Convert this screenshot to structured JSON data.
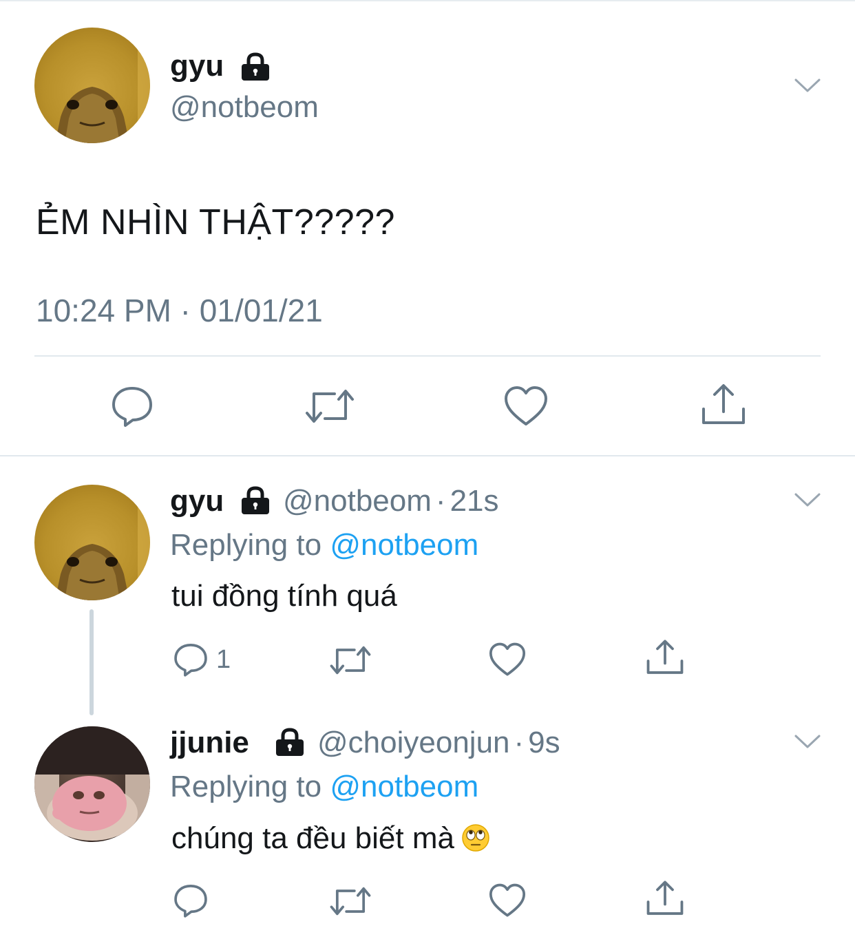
{
  "main_tweet": {
    "display_name": "gyu",
    "handle": "@notbeom",
    "text": "ẺM NHÌN THẬT?????",
    "timestamp": "10:24 PM · 01/01/21",
    "actions": [
      "reply-icon",
      "retweet-icon",
      "like-icon",
      "share-icon"
    ]
  },
  "replies": [
    {
      "display_name": "gyu",
      "handle": "@notbeom",
      "separator": "·",
      "time": "21s",
      "replying_prefix": "Replying to ",
      "replying_to": "@notbeom",
      "text": "tui đồng tính quá",
      "reply_count": "1"
    },
    {
      "display_name": "jjunie",
      "handle": "@choiyeonjun",
      "separator": "·",
      "time": "9s",
      "replying_prefix": "Replying to ",
      "replying_to": "@notbeom",
      "text": "chúng ta đều biết mà",
      "emoji": "face-with-rolling-eyes"
    }
  ],
  "colors": {
    "text": "#14171a",
    "secondary": "#657786",
    "link": "#1da1f2",
    "divider": "#e1e8ed"
  }
}
